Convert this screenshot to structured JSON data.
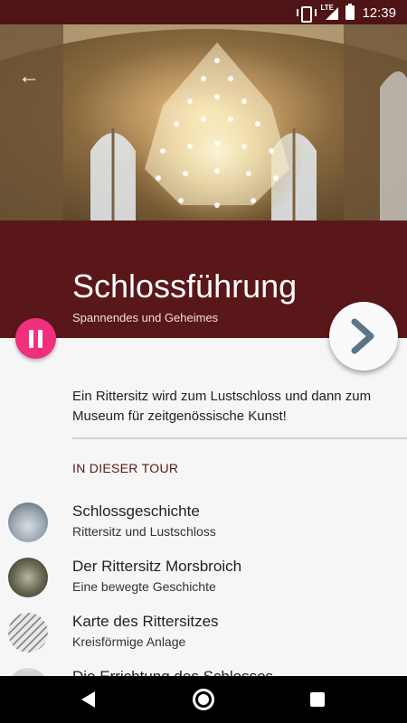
{
  "status_bar": {
    "time": "12:39",
    "network_label": "LTE"
  },
  "header": {
    "back_icon": "arrow-back-icon",
    "title": "Schlossführung",
    "subtitle": "Spannendes und Geheimes"
  },
  "controls": {
    "pause_icon": "pause-icon",
    "next_icon": "chevron-right-icon"
  },
  "description": "Ein Rittersitz wird zum Lustschloss und dann zum Museum für zeitgenössische Kunst!",
  "section_title": "IN DIESER TOUR",
  "tour_items": [
    {
      "title": "Schlossgeschichte",
      "subtitle": "Rittersitz und Lustschloss"
    },
    {
      "title": "Der Rittersitz Morsbroich",
      "subtitle": "Eine bewegte Geschichte"
    },
    {
      "title": "Karte des Rittersitzes",
      "subtitle": "Kreisförmige Anlage"
    },
    {
      "title": "Die Errichtung des Schlosses",
      "subtitle": ""
    }
  ],
  "colors": {
    "brand": "#5a1719",
    "accent": "#f0307f",
    "next_chevron": "#5b7486"
  }
}
